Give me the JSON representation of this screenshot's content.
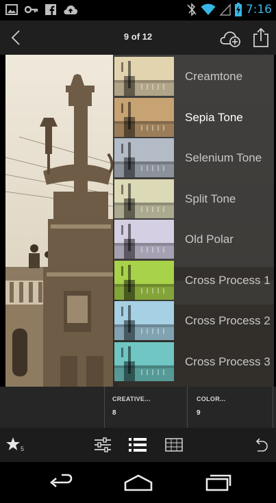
{
  "status_bar": {
    "time": "7:16",
    "left_icons": [
      "image-icon",
      "connection-icon",
      "facebook-icon",
      "cloud-upload-icon"
    ],
    "right_icons": [
      "bluetooth-off-icon",
      "wifi-icon",
      "signal-icon",
      "battery-charging-icon"
    ]
  },
  "header": {
    "counter": "9 of 12",
    "icons": [
      "back-icon",
      "cloud-add-icon",
      "share-icon"
    ]
  },
  "presets": [
    {
      "label": "Creamtone",
      "tint": "#e3d4b0",
      "selected": false
    },
    {
      "label": "Sepia Tone",
      "tint": "#c7a272",
      "selected": true
    },
    {
      "label": "Selenium Tone",
      "tint": "#b3bbc7",
      "selected": false
    },
    {
      "label": "Split Tone",
      "tint": "#dcd9b6",
      "selected": false
    },
    {
      "label": "Old Polar",
      "tint": "#d5cfe4",
      "selected": false
    },
    {
      "label": "Cross Process 1",
      "tint": "#a8d24a",
      "selected": false
    },
    {
      "label": "Cross Process 2",
      "tint": "#a6d0e3",
      "selected": false
    },
    {
      "label": "Cross Process 3",
      "tint": "#6fc6c2",
      "selected": false
    }
  ],
  "categories": [
    {
      "name": "CREATIVE...",
      "count": "8"
    },
    {
      "name": "COLOR...",
      "count": "9"
    }
  ],
  "toolbar": {
    "rating": "5",
    "icons": [
      "star-icon",
      "adjustments-icon",
      "presets-list-icon",
      "crop-icon",
      "undo-icon"
    ]
  },
  "navbar": {
    "icons": [
      "nav-back-icon",
      "nav-home-icon",
      "nav-recents-icon"
    ]
  },
  "colors": {
    "accent": "#37b6e6",
    "panel": "#232323",
    "photo_sepia": "#b9a992"
  }
}
